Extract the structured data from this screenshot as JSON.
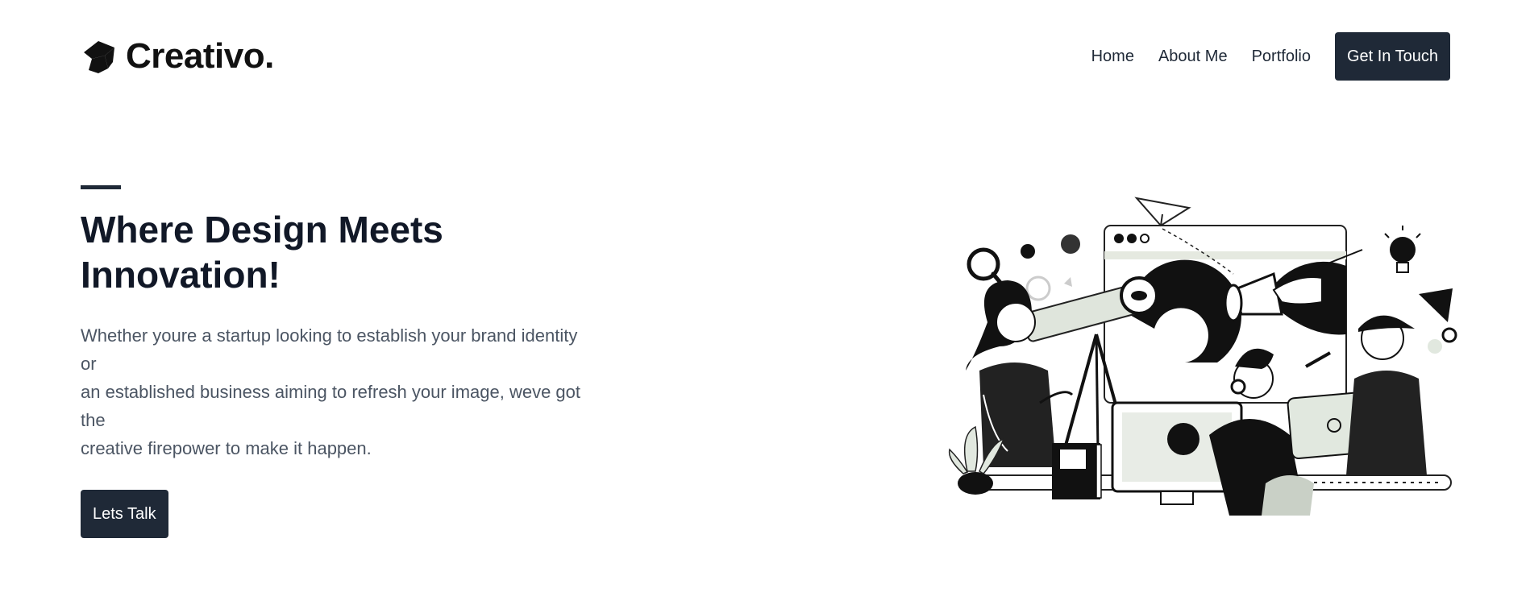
{
  "header": {
    "logo_text": "Creativo.",
    "nav": [
      {
        "label": "Home"
      },
      {
        "label": "About Me"
      },
      {
        "label": "Portfolio"
      }
    ],
    "cta_label": "Get In Touch"
  },
  "hero": {
    "title": "Where Design Meets Innovation!",
    "lines": [
      "Whether youre a startup looking to establish your brand identity",
      "or",
      "an established business aiming to refresh your image, weve got",
      "the",
      "creative firepower to make it happen."
    ],
    "button_label": "Lets Talk"
  },
  "colors": {
    "primary": "#1f2937",
    "heading": "#111827",
    "body_text": "#4b5563",
    "background": "#ffffff"
  },
  "icons": {
    "logo": "graduation-cap-icon",
    "illustration": "creative-team-illustration"
  }
}
